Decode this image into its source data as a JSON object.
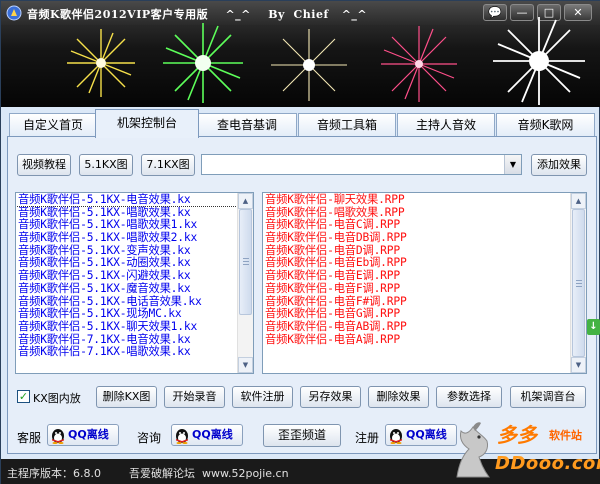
{
  "window": {
    "title": "音频K歌伴侣2012VIP客户专用版    ^_^    By  Chief   ^_^"
  },
  "title_buttons": {
    "message": "💬",
    "minimize": "—",
    "maximize": "□",
    "close": "✕"
  },
  "tabs": [
    {
      "label": "自定义首页",
      "active": false
    },
    {
      "label": "机架控制台",
      "active": true
    },
    {
      "label": "查电音基调",
      "active": false
    },
    {
      "label": "音频工具箱",
      "active": false
    },
    {
      "label": "主持人音效",
      "active": false
    },
    {
      "label": "音频K歌网",
      "active": false
    }
  ],
  "toolbar": {
    "video_tutorial": "视频教程",
    "kx51": "5.1KX图",
    "kx71": "7.1KX图",
    "combo_value": "",
    "add_effect": "添加效果"
  },
  "left_list": [
    "音频K歌伴侣-5.1KX-电音效果.kx",
    "音频K歌伴侣-5.1KX-唱歌效果.kx",
    "音频K歌伴侣-5.1KX-唱歌效果1.kx",
    "音频K歌伴侣-5.1KX-唱歌效果2.kx",
    "音频K歌伴侣-5.1KX-变声效果.kx",
    "音频K歌伴侣-5.1KX-动圈效果.kx",
    "音频K歌伴侣-5.1KX-闪避效果.kx",
    "音频K歌伴侣-5.1KX-魔音效果.kx",
    "音频K歌伴侣-5.1KX-电话音效果.kx",
    "音频K歌伴侣-5.1KX-现场MC.kx",
    "音频K歌伴侣-5.1KX-聊天效果1.kx",
    "音频K歌伴侣-7.1KX-电音效果.kx",
    "音频K歌伴侣-7.1KX-唱歌效果.kx"
  ],
  "right_list": [
    "音频K歌伴侣-聊天效果.RPP",
    "音频K歌伴侣-唱歌效果.RPP",
    "音频K歌伴侣-电音C调.RPP",
    "音频K歌伴侣-电音DB调.RPP",
    "音频K歌伴侣-电音D调.RPP",
    "音频K歌伴侣-电音Eb调.RPP",
    "音频K歌伴侣-电音E调.RPP",
    "音频K歌伴侣-电音F调.RPP",
    "音频K歌伴侣-电音F#调.RPP",
    "音频K歌伴侣-电音G调.RPP",
    "音频K歌伴侣-电音AB调.RPP",
    "音频K歌伴侣-电音A调.RPP"
  ],
  "actions": {
    "kx_checkbox_label": "KX图内放",
    "kx_checked": true,
    "delete_kx": "删除KX图",
    "start_record": "开始录音",
    "software_register": "软件注册",
    "save_effect": "另存效果",
    "delete_effect": "删除效果",
    "param_select": "参数选择",
    "rack_tune": "机架调音台"
  },
  "contacts": {
    "service_label": "客服",
    "consult_label": "咨询",
    "register_label": "注册",
    "qq_offline": "QQ离线",
    "channel_button": "歪歪频道"
  },
  "status": {
    "version": "主程序版本：6.8.0",
    "site": "吾爱破解论坛  www.52pojie.cn"
  },
  "watermark": {
    "line1": "多多",
    "line2": "软件站",
    "line3": "DDooo.com"
  },
  "colors": {
    "left_list_text": "#0000ee",
    "right_list_text": "#ff1010",
    "qq_text": "#0000cc",
    "panel_bg": "#e6eef9"
  }
}
